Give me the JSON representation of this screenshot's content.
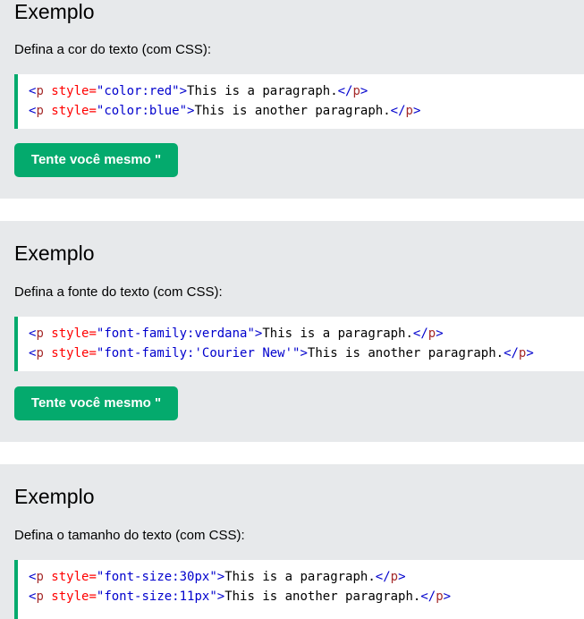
{
  "examples": [
    {
      "heading": "Exemplo",
      "description": "Defina a cor do texto (com CSS):",
      "lines": [
        {
          "open_bracket": "<",
          "tag": "p",
          "attr": " style=",
          "value": "\"color:red\"",
          "close_bracket": ">",
          "text": "This is a paragraph.",
          "end_open": "</",
          "end_tag": "p",
          "end_close": ">"
        },
        {
          "open_bracket": "<",
          "tag": "p",
          "attr": " style=",
          "value": "\"color:blue\"",
          "close_bracket": ">",
          "text": "This is another paragraph.",
          "end_open": "</",
          "end_tag": "p",
          "end_close": ">"
        }
      ],
      "button": "Tente você mesmo \""
    },
    {
      "heading": "Exemplo",
      "description": "Defina a fonte do texto (com CSS):",
      "lines": [
        {
          "open_bracket": "<",
          "tag": "p",
          "attr": " style=",
          "value": "\"font-family:verdana\"",
          "close_bracket": ">",
          "text": "This is a paragraph.",
          "end_open": "</",
          "end_tag": "p",
          "end_close": ">"
        },
        {
          "open_bracket": "<",
          "tag": "p",
          "attr": " style=",
          "value": "\"font-family:'Courier New'\"",
          "close_bracket": ">",
          "text": "This is another paragraph.",
          "end_open": "</",
          "end_tag": "p",
          "end_close": ">"
        }
      ],
      "button": "Tente você mesmo \""
    },
    {
      "heading": "Exemplo",
      "description": "Defina o tamanho do texto (com CSS):",
      "lines": [
        {
          "open_bracket": "<",
          "tag": "p",
          "attr": " style=",
          "value": "\"font-size:30px\"",
          "close_bracket": ">",
          "text": "This is a paragraph.",
          "end_open": "</",
          "end_tag": "p",
          "end_close": ">"
        },
        {
          "open_bracket": "<",
          "tag": "p",
          "attr": " style=",
          "value": "\"font-size:11px\"",
          "close_bracket": ">",
          "text": "This is another paragraph.",
          "end_open": "</",
          "end_tag": "p",
          "end_close": ">"
        }
      ]
    }
  ],
  "colors": {
    "panel_bg": "#e7e9eb",
    "accent": "#04aa6d",
    "code_tag": "#a52a2a",
    "code_attr": "#ff0000",
    "code_value": "#0000cd"
  }
}
